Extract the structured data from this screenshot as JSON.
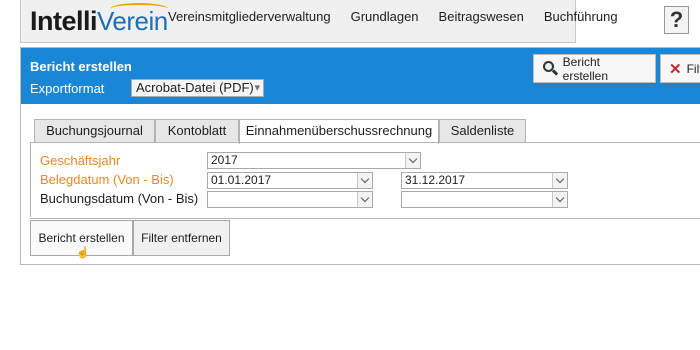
{
  "brand": {
    "part1": "Intelli",
    "part2": "Verein"
  },
  "nav": {
    "items": [
      "Vereinsmitgliederverwaltung",
      "Grundlagen",
      "Beitragswesen",
      "Buchführung"
    ],
    "help": "?"
  },
  "panel": {
    "title": "Bericht erstellen",
    "export_label": "Exportformat",
    "export_value": "Acrobat-Datei (PDF)",
    "header_buttons": {
      "report": "Bericht erstellen",
      "filter": "Filter"
    }
  },
  "tabs": [
    {
      "label": "Buchungsjournal",
      "active": false
    },
    {
      "label": "Kontoblatt",
      "active": false
    },
    {
      "label": "Einnahmenüberschussrechnung",
      "active": true
    },
    {
      "label": "Saldenliste",
      "active": false
    }
  ],
  "form": {
    "fiscal_year": {
      "label": "Geschäftsjahr",
      "value": "2017"
    },
    "document_date": {
      "label": "Belegdatum (Von - Bis)",
      "from": "01.01.2017",
      "to": "31.12.2017"
    },
    "booking_date": {
      "label": "Buchungsdatum (Von - Bis)",
      "from": "",
      "to": ""
    }
  },
  "footer_buttons": {
    "create": "Bericht erstellen",
    "clear": "Filter entfernen"
  },
  "colors": {
    "header_blue": "#1a86d6",
    "label_orange": "#e8891e",
    "brand_blue": "#1d6fb8"
  }
}
